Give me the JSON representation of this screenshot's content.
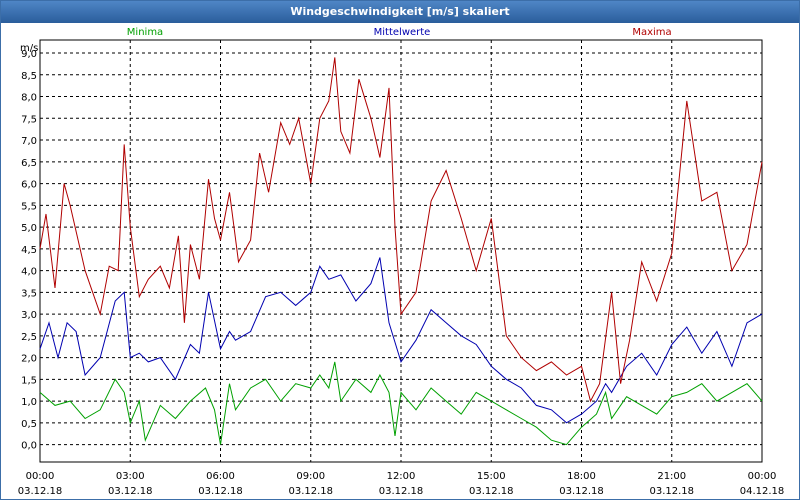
{
  "window": {
    "title": "Windgeschwindigkeit [m/s] skaliert"
  },
  "chart_data": {
    "type": "line",
    "title": "Windgeschwindigkeit [m/s] skaliert",
    "ylabel": "m/s",
    "ylim": [
      -0.4,
      9.3
    ],
    "xlim": [
      0,
      24
    ],
    "grid": true,
    "legend_placement": "top",
    "y_ticks": [
      "9,0",
      "8,5",
      "8,0",
      "7,5",
      "7,0",
      "6,5",
      "6,0",
      "5,5",
      "5,0",
      "4,5",
      "4,0",
      "3,5",
      "3,0",
      "2,5",
      "2,0",
      "1,5",
      "1,0",
      "0,5",
      "0,0"
    ],
    "y_tick_values": [
      9.0,
      8.5,
      8.0,
      7.5,
      7.0,
      6.5,
      6.0,
      5.5,
      5.0,
      4.5,
      4.0,
      3.5,
      3.0,
      2.5,
      2.0,
      1.5,
      1.0,
      0.5,
      0.0
    ],
    "x_ticks": [
      {
        "time": "00:00",
        "date": "03.12.18"
      },
      {
        "time": "03:00",
        "date": "03.12.18"
      },
      {
        "time": "06:00",
        "date": "03.12.18"
      },
      {
        "time": "09:00",
        "date": "03.12.18"
      },
      {
        "time": "12:00",
        "date": "03.12.18"
      },
      {
        "time": "15:00",
        "date": "03.12.18"
      },
      {
        "time": "18:00",
        "date": "03.12.18"
      },
      {
        "time": "21:00",
        "date": "03.12.18"
      },
      {
        "time": "00:00",
        "date": "04.12.18"
      }
    ],
    "x_tick_values": [
      0,
      3,
      6,
      9,
      12,
      15,
      18,
      21,
      24
    ],
    "series": [
      {
        "name": "Minima",
        "color": "#00a000",
        "x": [
          0,
          0.5,
          1,
          1.5,
          2,
          2.5,
          2.8,
          3,
          3.3,
          3.5,
          4,
          4.5,
          5,
          5.5,
          5.8,
          6,
          6.3,
          6.5,
          7,
          7.5,
          8,
          8.5,
          9,
          9.3,
          9.6,
          9.8,
          10,
          10.5,
          11,
          11.3,
          11.6,
          11.8,
          12,
          12.5,
          13,
          13.5,
          14,
          14.5,
          15,
          15.5,
          16,
          16.5,
          17,
          17.5,
          18,
          18.5,
          18.8,
          19,
          19.5,
          20,
          20.5,
          21,
          21.5,
          22,
          22.5,
          23,
          23.5,
          24
        ],
        "values": [
          1.2,
          0.9,
          1.0,
          0.6,
          0.8,
          1.5,
          1.2,
          0.5,
          1.0,
          0.1,
          0.9,
          0.6,
          1.0,
          1.3,
          0.8,
          0.0,
          1.4,
          0.8,
          1.3,
          1.5,
          1.0,
          1.4,
          1.3,
          1.6,
          1.3,
          1.9,
          1.0,
          1.5,
          1.2,
          1.6,
          1.2,
          0.2,
          1.2,
          0.8,
          1.3,
          1.0,
          0.7,
          1.2,
          1.0,
          0.8,
          0.6,
          0.4,
          0.1,
          0.0,
          0.4,
          0.7,
          1.2,
          0.6,
          1.1,
          0.9,
          0.7,
          1.1,
          1.2,
          1.4,
          1.0,
          1.2,
          1.4,
          1.0
        ]
      },
      {
        "name": "Mittelwerte",
        "color": "#0000b0",
        "x": [
          0,
          0.3,
          0.6,
          0.9,
          1.2,
          1.5,
          2,
          2.5,
          2.8,
          3,
          3.3,
          3.6,
          4,
          4.5,
          5,
          5.3,
          5.6,
          6,
          6.3,
          6.5,
          7,
          7.5,
          8,
          8.5,
          9,
          9.3,
          9.6,
          10,
          10.5,
          11,
          11.3,
          11.6,
          12,
          12.5,
          13,
          13.5,
          14,
          14.5,
          15,
          15.5,
          16,
          16.5,
          17,
          17.5,
          18,
          18.5,
          18.8,
          19,
          19.5,
          20,
          20.5,
          21,
          21.5,
          22,
          22.5,
          23,
          23.5,
          24
        ],
        "values": [
          2.2,
          2.8,
          2.0,
          2.8,
          2.6,
          1.6,
          2.0,
          3.3,
          3.5,
          2.0,
          2.1,
          1.9,
          2.0,
          1.5,
          2.3,
          2.1,
          3.5,
          2.2,
          2.6,
          2.4,
          2.6,
          3.4,
          3.5,
          3.2,
          3.5,
          4.1,
          3.8,
          3.9,
          3.3,
          3.7,
          4.3,
          2.8,
          1.9,
          2.4,
          3.1,
          2.8,
          2.5,
          2.3,
          1.8,
          1.5,
          1.3,
          0.9,
          0.8,
          0.5,
          0.7,
          1.0,
          1.4,
          1.2,
          1.8,
          2.1,
          1.6,
          2.3,
          2.7,
          2.1,
          2.6,
          1.8,
          2.8,
          3.0
        ]
      },
      {
        "name": "Maxima",
        "color": "#b00000",
        "x": [
          0,
          0.2,
          0.5,
          0.8,
          1,
          1.5,
          2,
          2.3,
          2.6,
          2.8,
          3,
          3.3,
          3.6,
          4,
          4.3,
          4.6,
          4.8,
          5,
          5.3,
          5.6,
          5.8,
          6,
          6.3,
          6.6,
          7,
          7.3,
          7.6,
          8,
          8.3,
          8.6,
          9,
          9.3,
          9.6,
          9.8,
          10,
          10.3,
          10.6,
          11,
          11.3,
          11.6,
          11.8,
          12,
          12.5,
          13,
          13.5,
          14,
          14.5,
          15,
          15.5,
          16,
          16.5,
          17,
          17.5,
          18,
          18.3,
          18.6,
          19,
          19.3,
          19.6,
          20,
          20.5,
          21,
          21.5,
          22,
          22.5,
          23,
          23.5,
          24
        ],
        "values": [
          4.5,
          5.3,
          3.6,
          6.0,
          5.5,
          4.0,
          3.0,
          4.1,
          4.0,
          6.9,
          5.0,
          3.4,
          3.8,
          4.1,
          3.6,
          4.8,
          2.8,
          4.6,
          3.8,
          6.1,
          5.2,
          4.7,
          5.8,
          4.2,
          4.7,
          6.7,
          5.8,
          7.4,
          6.9,
          7.5,
          6.0,
          7.5,
          7.9,
          8.9,
          7.2,
          6.7,
          8.4,
          7.5,
          6.6,
          8.2,
          5.0,
          3.0,
          3.5,
          5.6,
          6.3,
          5.2,
          4.0,
          5.2,
          2.5,
          2.0,
          1.7,
          1.9,
          1.6,
          1.8,
          1.0,
          1.4,
          3.5,
          1.4,
          2.4,
          4.2,
          3.3,
          4.4,
          7.9,
          5.6,
          5.8,
          4.0,
          4.6,
          6.5
        ]
      }
    ]
  }
}
